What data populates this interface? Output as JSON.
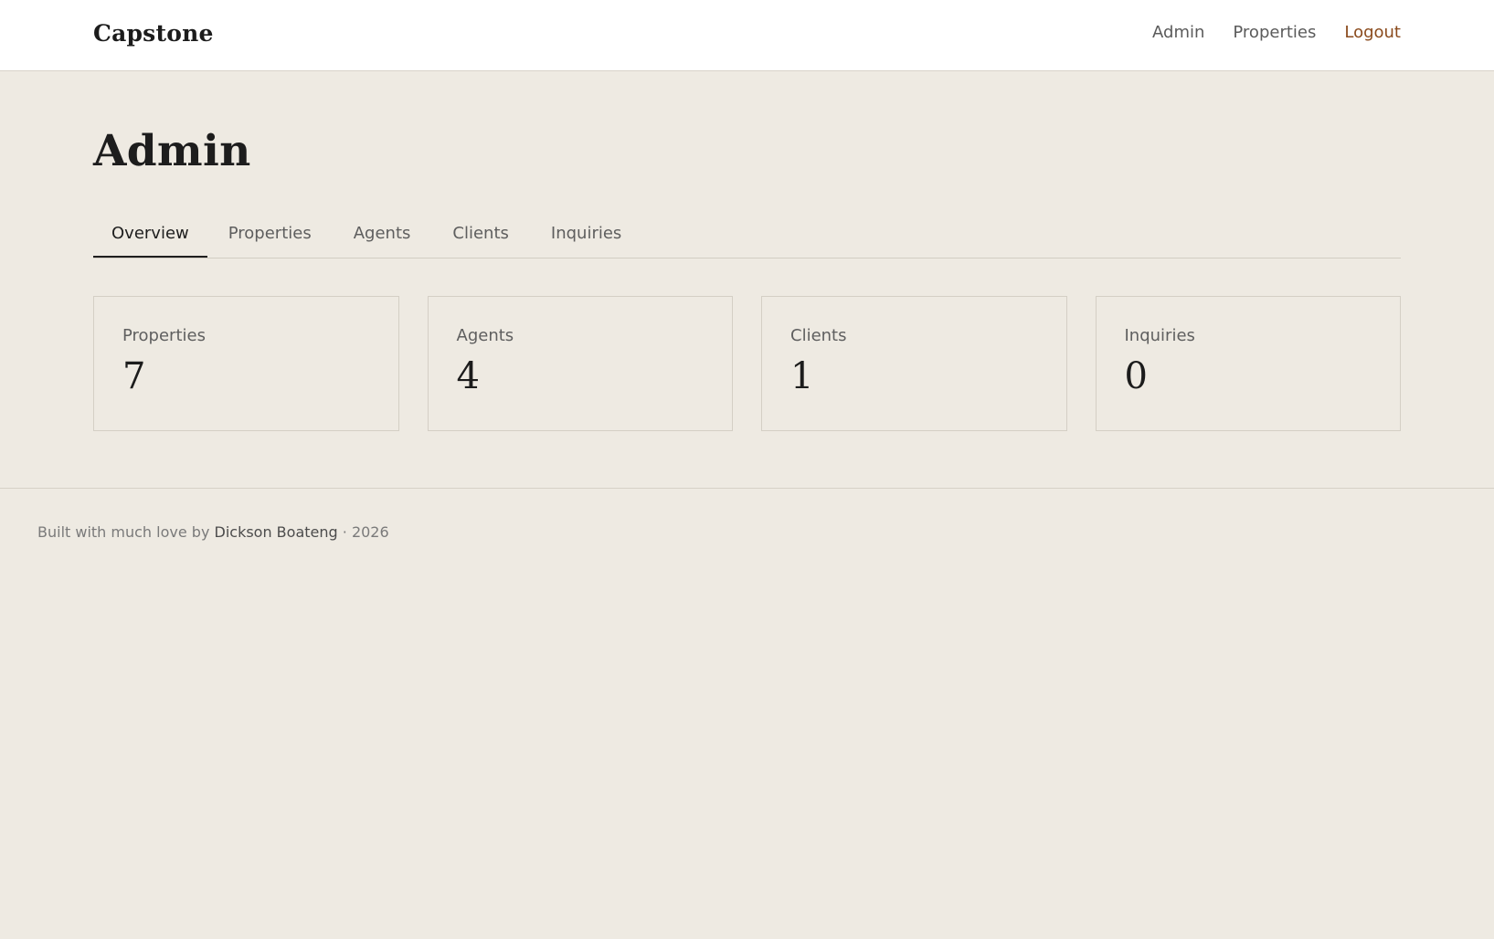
{
  "header": {
    "brand": "Capstone",
    "nav": {
      "admin": "Admin",
      "properties": "Properties",
      "logout": "Logout"
    }
  },
  "page": {
    "title": "Admin"
  },
  "tabs": [
    {
      "label": "Overview",
      "active": true
    },
    {
      "label": "Properties",
      "active": false
    },
    {
      "label": "Agents",
      "active": false
    },
    {
      "label": "Clients",
      "active": false
    },
    {
      "label": "Inquiries",
      "active": false
    }
  ],
  "stats": [
    {
      "label": "Properties",
      "value": "7"
    },
    {
      "label": "Agents",
      "value": "4"
    },
    {
      "label": "Clients",
      "value": "1"
    },
    {
      "label": "Inquiries",
      "value": "0"
    }
  ],
  "footer": {
    "prefix": "Built with much love by",
    "author": "Dickson Boateng",
    "suffix": "· 2026"
  },
  "colors": {
    "background": "#eeeae2",
    "header_bg": "#ffffff",
    "accent_logout": "#8a4a1c"
  }
}
